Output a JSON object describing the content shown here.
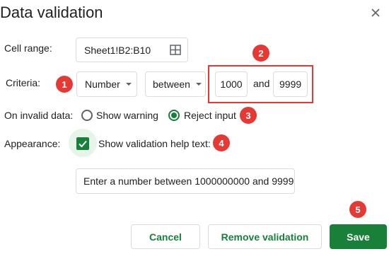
{
  "dialog": {
    "title": "Data validation",
    "close_icon": "close-icon"
  },
  "cell_range": {
    "label": "Cell range:",
    "value": "Sheet1!B2:B10",
    "icon": "grid-icon"
  },
  "criteria": {
    "label": "Criteria:",
    "type_value": "Number",
    "operator_value": "between",
    "min_value": "1000",
    "and_label": "and",
    "max_value": "9999"
  },
  "on_invalid": {
    "label": "On invalid data:",
    "options": [
      {
        "label": "Show warning",
        "selected": false
      },
      {
        "label": "Reject input",
        "selected": true
      }
    ]
  },
  "appearance": {
    "label": "Appearance:",
    "checkbox_label": "Show validation help text:",
    "checked": true,
    "help_text_value": "Enter a number between 1000000000 and 9999"
  },
  "badges": [
    "1",
    "2",
    "3",
    "4",
    "5"
  ],
  "buttons": {
    "cancel": "Cancel",
    "remove": "Remove validation",
    "save": "Save"
  },
  "colors": {
    "accent_green": "#188038",
    "badge_red": "#e53935",
    "border_gray": "#dadce0"
  }
}
